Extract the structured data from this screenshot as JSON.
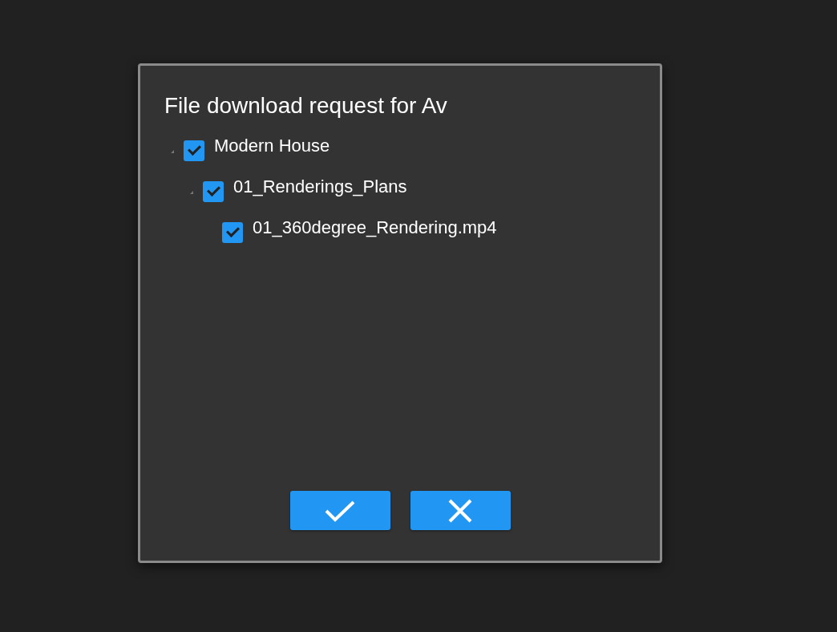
{
  "dialog": {
    "title": "File download request for Av",
    "tree": [
      {
        "label": "Modern House",
        "checked": true,
        "expanded": true,
        "children": [
          {
            "label": "01_Renderings_Plans",
            "checked": true,
            "expanded": true,
            "children": [
              {
                "label": "01_360degree_Rendering.mp4",
                "checked": true
              }
            ]
          }
        ]
      }
    ]
  }
}
